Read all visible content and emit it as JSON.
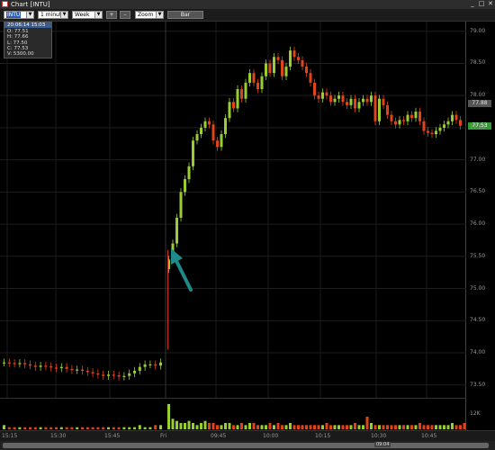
{
  "window": {
    "title": "Chart [INTU]",
    "minimize": "_",
    "maximize": "□",
    "close": "✕",
    "icon": "app-icon"
  },
  "toolbar": {
    "symbol": "INTU",
    "interval": "1 minute",
    "period": "Week",
    "zoom_in_label": "+",
    "zoom_out_label": "–",
    "zoom_label": "Zoom",
    "chart_type_label": "Bar"
  },
  "infobox": {
    "header": "20:06:14 15:03",
    "open": "O: 77.51",
    "high": "H: 77.66",
    "low": "L: 77.50",
    "close": "C: 77.53",
    "volume": "V: 5300.00"
  },
  "colors": {
    "up": "#9acd32",
    "down": "#e0441a",
    "arrow": "#1e8a8a",
    "last_price_bg": "#2f9e2f"
  },
  "last_price": "77.53",
  "last_price_alt": "77.88",
  "volume_axis_label": "12K",
  "scroll_marker": "09:04",
  "chart_data": {
    "type": "candlestick",
    "ylim": [
      73.3,
      79.15
    ],
    "yticks": [
      "79.00",
      "78.50",
      "78.00",
      "77.50",
      "77.00",
      "76.50",
      "76.00",
      "75.50",
      "75.00",
      "74.50",
      "74.00",
      "73.50"
    ],
    "xticks": [
      "15:15",
      "15:30",
      "15:45",
      "Fri",
      "09:45",
      "10:00",
      "10:15",
      "10:30",
      "10:45"
    ],
    "close_path": [
      73.85,
      73.84,
      73.83,
      73.84,
      73.82,
      73.8,
      73.78,
      73.8,
      73.79,
      73.77,
      73.76,
      73.78,
      73.75,
      73.73,
      73.74,
      73.72,
      73.7,
      73.68,
      73.66,
      73.64,
      73.66,
      73.65,
      73.63,
      73.64,
      73.68,
      73.72,
      73.78,
      73.82,
      73.82,
      73.8,
      73.85,
      75.45,
      75.7,
      76.1,
      76.5,
      76.7,
      76.9,
      77.3,
      77.4,
      77.5,
      77.6,
      77.55,
      77.3,
      77.2,
      77.4,
      77.65,
      77.9,
      77.8,
      78.1,
      77.95,
      78.2,
      78.35,
      78.2,
      78.1,
      78.3,
      78.5,
      78.35,
      78.6,
      78.55,
      78.3,
      78.45,
      78.7,
      78.6,
      78.55,
      78.45,
      78.35,
      78.2,
      78.0,
      77.95,
      78.05,
      78.0,
      77.9,
      77.95,
      78.0,
      77.9,
      77.85,
      77.95,
      77.8,
      77.9,
      77.95,
      77.9,
      78.0,
      77.6,
      77.95,
      77.85,
      77.7,
      77.6,
      77.55,
      77.62,
      77.6,
      77.7,
      77.65,
      77.75,
      77.6,
      77.45,
      77.42,
      77.4,
      77.45,
      77.5,
      77.55,
      77.6,
      77.7,
      77.62,
      77.53
    ],
    "volume": [
      2,
      1,
      1,
      1,
      1,
      1,
      1,
      1,
      1,
      1,
      1,
      1,
      1,
      1,
      1,
      1,
      1,
      1,
      1,
      1,
      1,
      1,
      1,
      1,
      1,
      1,
      2,
      1,
      1,
      2,
      2,
      12,
      5,
      4,
      3,
      3,
      4,
      3,
      2,
      3,
      4,
      3,
      3,
      2,
      2,
      3,
      3,
      2,
      2,
      3,
      2,
      3,
      3,
      2,
      2,
      2,
      3,
      2,
      3,
      2,
      2,
      3,
      2,
      2,
      2,
      2,
      2,
      2,
      2,
      2,
      3,
      2,
      2,
      2,
      2,
      2,
      2,
      3,
      2,
      2,
      6,
      3,
      2,
      2,
      2,
      2,
      2,
      2,
      2,
      2,
      2,
      2,
      2,
      3,
      2,
      2,
      2,
      2,
      2,
      2,
      2,
      3,
      2,
      2,
      3,
      2
    ]
  }
}
